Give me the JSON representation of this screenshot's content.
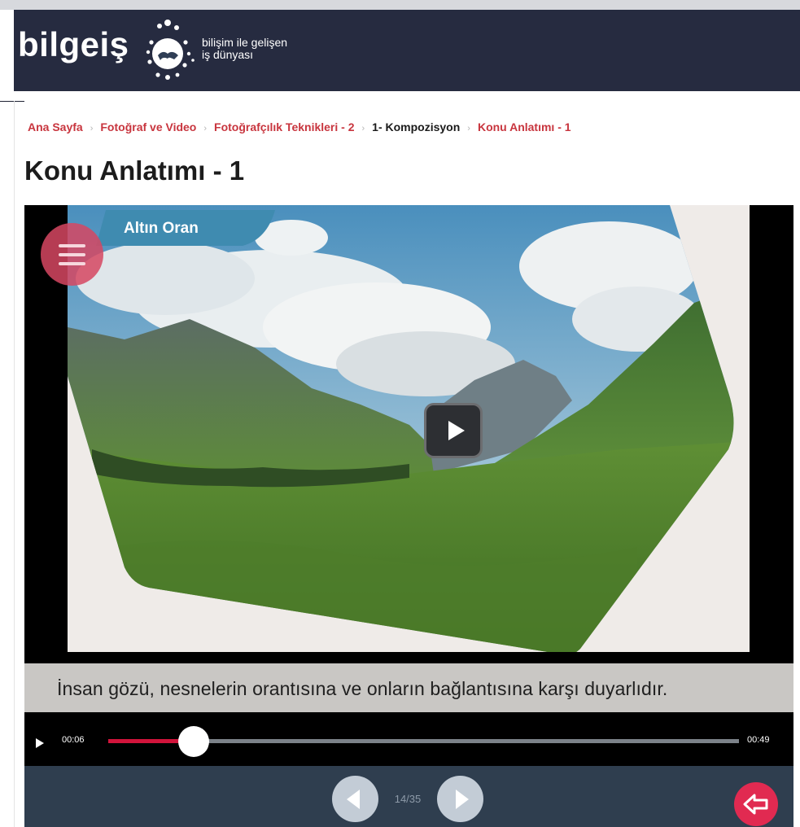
{
  "header": {
    "logo_text": "bilgeiş",
    "tagline_line1": "bilişim ile gelişen",
    "tagline_line2": "iş dünyası"
  },
  "breadcrumb": [
    {
      "label": "Ana Sayfa",
      "current": false
    },
    {
      "label": "Fotoğraf ve Video",
      "current": false
    },
    {
      "label": "Fotoğrafçılık Teknikleri - 2",
      "current": false
    },
    {
      "label": "1- Kompozisyon",
      "current": true
    },
    {
      "label": "Konu Anlatımı - 1",
      "current": false
    }
  ],
  "breadcrumb_separator": "›",
  "page_title": "Konu Anlatımı - 1",
  "player": {
    "section_tab": "Altın Oran",
    "caption": "İnsan gözü, nesnelerin orantısına ve onların bağlantısına karşı duyarlıdır.",
    "current_time": "00:06",
    "total_time": "00:49",
    "progress_percent": 13.5,
    "buffered_percent": 96,
    "page_indicator": "14/35"
  },
  "colors": {
    "header_bg": "#262b40",
    "breadcrumb_link": "#c8353e",
    "progress": "#d2143b",
    "exit_button": "#e12a51",
    "tab": "#3f8bb0"
  },
  "icons": {
    "menu": "hamburger-icon",
    "play": "play-icon",
    "prev": "arrow-left-icon",
    "next": "arrow-right-icon",
    "exit": "exit-arrow-icon"
  }
}
